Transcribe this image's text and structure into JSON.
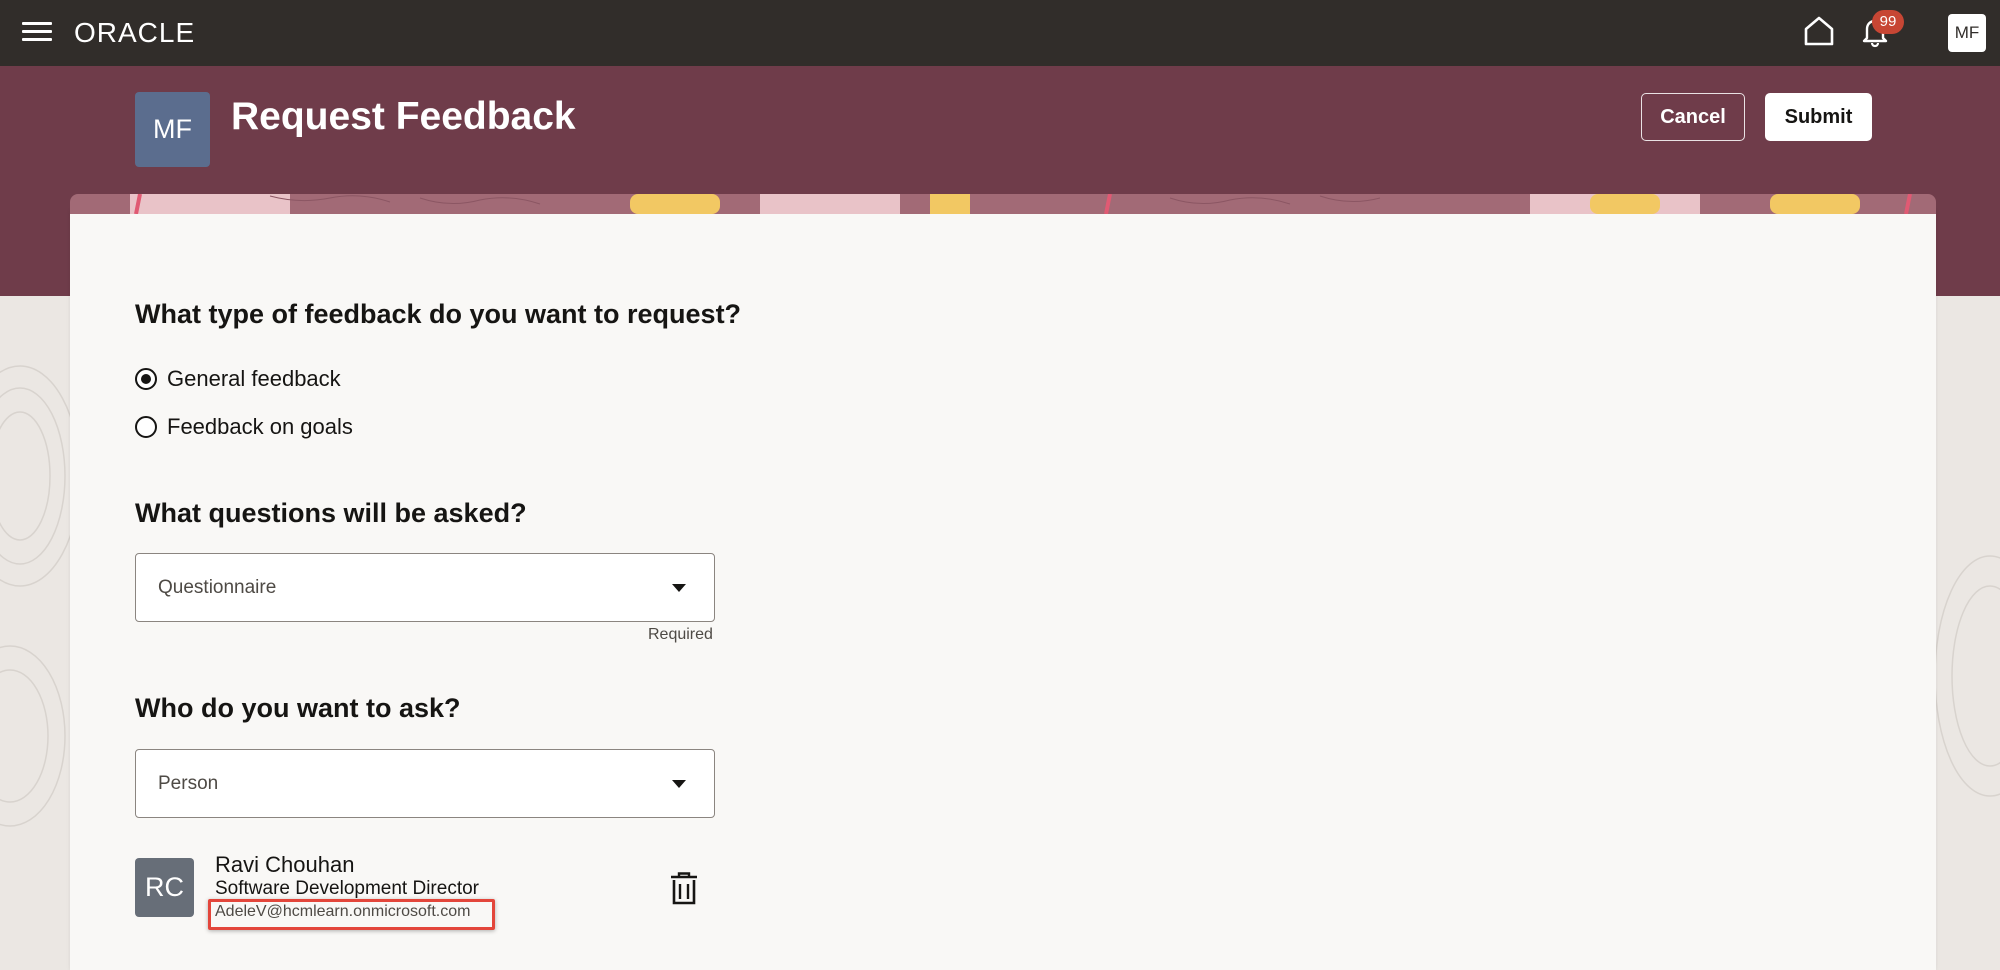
{
  "topbar": {
    "brand": "ORACLE",
    "notification_count": "99",
    "user_initials": "MF",
    "icons": [
      "menu-icon",
      "home-icon",
      "bell-icon"
    ]
  },
  "header": {
    "avatar_initials": "MF",
    "title": "Request Feedback",
    "cancel_label": "Cancel",
    "submit_label": "Submit",
    "band_color": "#6f3c4a"
  },
  "form": {
    "feedback_type": {
      "heading": "What type of feedback do you want to request?",
      "options": [
        {
          "label": "General feedback",
          "selected": true
        },
        {
          "label": "Feedback on goals",
          "selected": false
        }
      ]
    },
    "questions": {
      "heading": "What questions will be asked?",
      "placeholder": "Questionnaire",
      "helper": "Required"
    },
    "ask": {
      "heading": "Who do you want to ask?",
      "placeholder": "Person"
    },
    "selected_person": {
      "initials": "RC",
      "name": "Ravi Chouhan",
      "title": "Software Development Director",
      "email": "AdeleV@hcmlearn.onmicrosoft.com"
    }
  },
  "colors": {
    "topbar": "#312d2a",
    "accent_highlight": "#e3463b",
    "badge": "#c74634"
  }
}
